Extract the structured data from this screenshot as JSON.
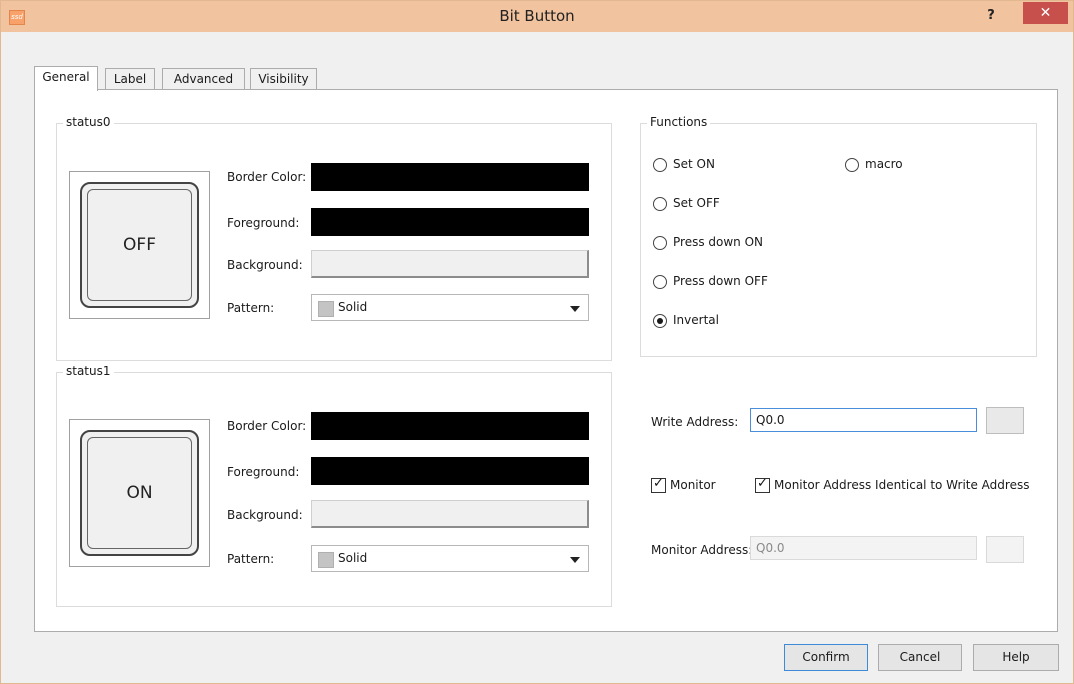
{
  "window": {
    "title": "Bit Button",
    "icon_text": "ssd",
    "help_glyph": "?",
    "close_glyph": "✕"
  },
  "tabs": [
    {
      "label": "General",
      "active": true
    },
    {
      "label": "Label",
      "active": false
    },
    {
      "label": "Advanced",
      "active": false
    },
    {
      "label": "Visibility",
      "active": false
    }
  ],
  "status0": {
    "title": "status0",
    "preview_text": "OFF",
    "border_color_label": "Border Color:",
    "foreground_label": "Foreground:",
    "background_label": "Background:",
    "pattern_label": "Pattern:",
    "border_color": "#000000",
    "foreground_color": "#000000",
    "background_color": "#f0f0f0",
    "pattern_value": "Solid"
  },
  "status1": {
    "title": "status1",
    "preview_text": "ON",
    "border_color_label": "Border Color:",
    "foreground_label": "Foreground:",
    "background_label": "Background:",
    "pattern_label": "Pattern:",
    "border_color": "#000000",
    "foreground_color": "#000000",
    "background_color": "#f0f0f0",
    "pattern_value": "Solid"
  },
  "functions": {
    "title": "Functions",
    "options": [
      {
        "label": "Set ON",
        "selected": false
      },
      {
        "label": "macro",
        "selected": false
      },
      {
        "label": "Set OFF",
        "selected": false
      },
      {
        "label": "Press down ON",
        "selected": false
      },
      {
        "label": "Press down OFF",
        "selected": false
      },
      {
        "label": "Invertal",
        "selected": true
      }
    ]
  },
  "address": {
    "write_label": "Write Address:",
    "write_value": "Q0.0",
    "monitor_checkbox_label": "Monitor",
    "monitor_checked": true,
    "identical_checkbox_label": "Monitor Address Identical to Write Address",
    "identical_checked": true,
    "monitor_address_label": "Monitor Address:",
    "monitor_address_value": "Q0.0"
  },
  "buttons": {
    "confirm": "Confirm",
    "cancel": "Cancel",
    "help": "Help"
  }
}
